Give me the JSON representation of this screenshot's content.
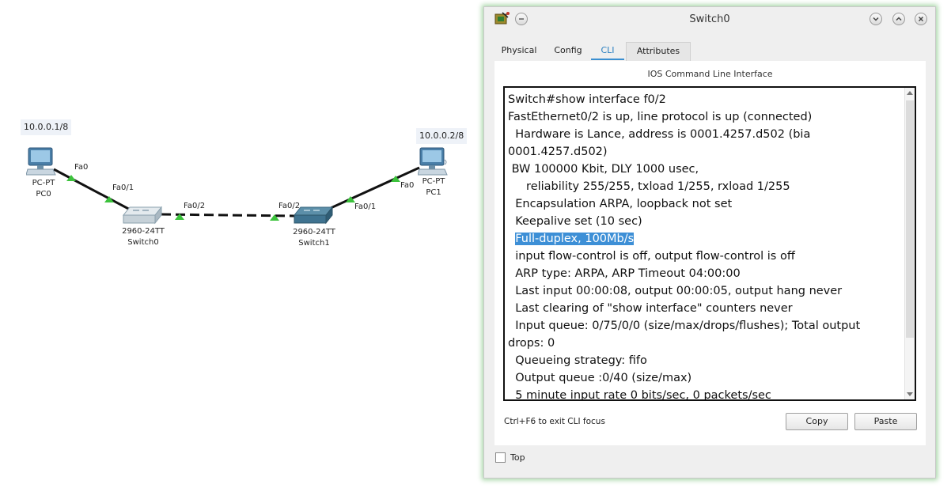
{
  "topology": {
    "pc0": {
      "ip": "10.0.0.1/8",
      "type": "PC-PT",
      "name": "PC0",
      "port": "Fa0"
    },
    "pc1": {
      "ip": "10.0.0.2/8",
      "type": "PC-PT",
      "name": "PC1",
      "port": "Fa0"
    },
    "switch0": {
      "model": "2960-24TT",
      "name": "Switch0",
      "port_pc": "Fa0/1",
      "port_trunk": "Fa0/2"
    },
    "switch1": {
      "model": "2960-24TT",
      "name": "Switch1",
      "port_pc": "Fa0/1",
      "port_trunk": "Fa0/2"
    },
    "link_color": "#111111",
    "port_indicator_color": "#3cc23c"
  },
  "window": {
    "title": "Switch0",
    "tabs": [
      {
        "label": "Physical"
      },
      {
        "label": "Config"
      },
      {
        "label": "CLI"
      },
      {
        "label": "Attributes"
      }
    ],
    "active_tab": "CLI",
    "panel_header": "IOS Command Line Interface",
    "cli_lines": [
      "Switch#show interface f0/2",
      "FastEthernet0/2 is up, line protocol is up (connected)",
      "  Hardware is Lance, address is 0001.4257.d502 (bia",
      "0001.4257.d502)",
      " BW 100000 Kbit, DLY 1000 usec,",
      "     reliability 255/255, txload 1/255, rxload 1/255",
      "  Encapsulation ARPA, loopback not set",
      "  Keepalive set (10 sec)",
      "  Full-duplex, 100Mb/s",
      "  input flow-control is off, output flow-control is off",
      "  ARP type: ARPA, ARP Timeout 04:00:00",
      "  Last input 00:00:08, output 00:00:05, output hang never",
      "  Last clearing of \"show interface\" counters never",
      "  Input queue: 0/75/0/0 (size/max/drops/flushes); Total output",
      "drops: 0",
      "  Queueing strategy: fifo",
      "  Output queue :0/40 (size/max)",
      "  5 minute input rate 0 bits/sec, 0 packets/sec"
    ],
    "highlighted_text": "Full-duplex, 100Mb/s",
    "hint": "Ctrl+F6 to exit CLI focus",
    "copy_label": "Copy",
    "paste_label": "Paste",
    "top_label": "Top",
    "top_checked": false,
    "highlight_color": "#3d8fd6",
    "window_glow_color": "#a6d6a6"
  }
}
